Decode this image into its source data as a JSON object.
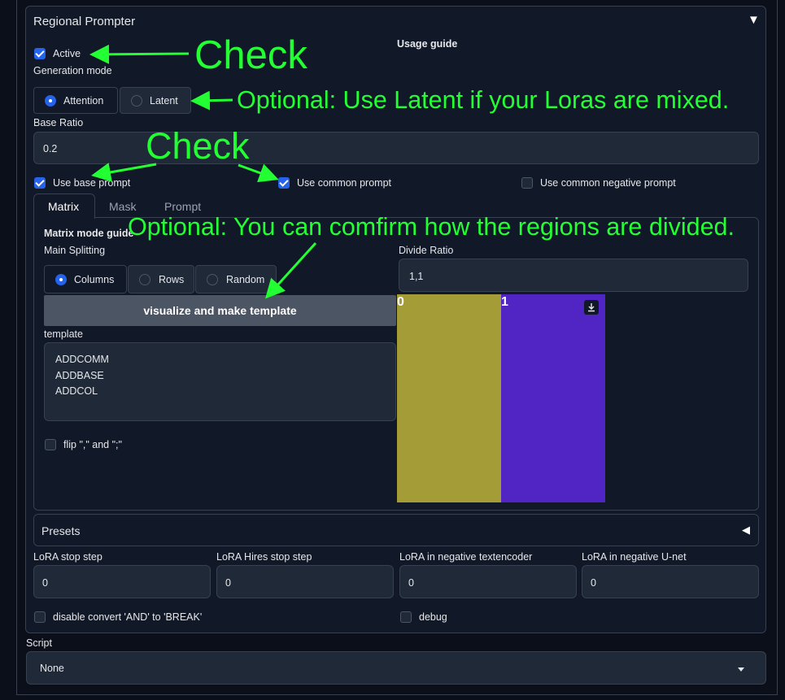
{
  "regional_prompter": {
    "title": "Regional Prompter",
    "collapse_glyph": "▼",
    "usage_guide": "Usage guide",
    "active_label": "Active",
    "generation_mode_label": "Generation mode",
    "generation_modes": [
      "Attention",
      "Latent"
    ],
    "base_ratio_label": "Base Ratio",
    "base_ratio_value": "0.2",
    "use_base_prompt": "Use base prompt",
    "use_common_prompt": "Use common prompt",
    "use_common_negative_prompt": "Use common negative prompt",
    "tabs": [
      "Matrix",
      "Mask",
      "Prompt"
    ],
    "matrix": {
      "guide": "Matrix mode guide",
      "main_splitting_label": "Main Splitting",
      "splitting_options": [
        "Columns",
        "Rows",
        "Random"
      ],
      "visualize_button": "visualize and make template",
      "template_label": "template",
      "template_lines": [
        "ADDCOMM",
        "ADDBASE",
        "ADDCOL"
      ],
      "flip_label": "flip \",\" and \";\"",
      "divide_ratio_label": "Divide Ratio",
      "divide_ratio_value": "1,1",
      "regions": [
        {
          "label": "0",
          "color": "#a39c37"
        },
        {
          "label": "1",
          "color": "#5125c4"
        }
      ]
    },
    "presets_label": "Presets",
    "presets_glyph": "◀",
    "lora_fields": [
      {
        "label": "LoRA stop step",
        "value": "0"
      },
      {
        "label": "LoRA Hires stop step",
        "value": "0"
      },
      {
        "label": "LoRA in negative textencoder",
        "value": "0"
      },
      {
        "label": "LoRA in negative U-net",
        "value": "0"
      }
    ],
    "disable_convert_label": "disable convert 'AND' to 'BREAK'",
    "debug_label": "debug"
  },
  "script": {
    "label": "Script",
    "value": "None"
  },
  "annotations": {
    "check1": "Check",
    "latent_note": "Optional: Use Latent if your Loras are mixed.",
    "check2": "Check",
    "visualize_note": "Optional: You can comfirm how the regions are divided."
  },
  "colors": {
    "accent": "#2563eb",
    "annotation": "#22ff33",
    "background": "#0b0f19",
    "panel": "#111827"
  }
}
